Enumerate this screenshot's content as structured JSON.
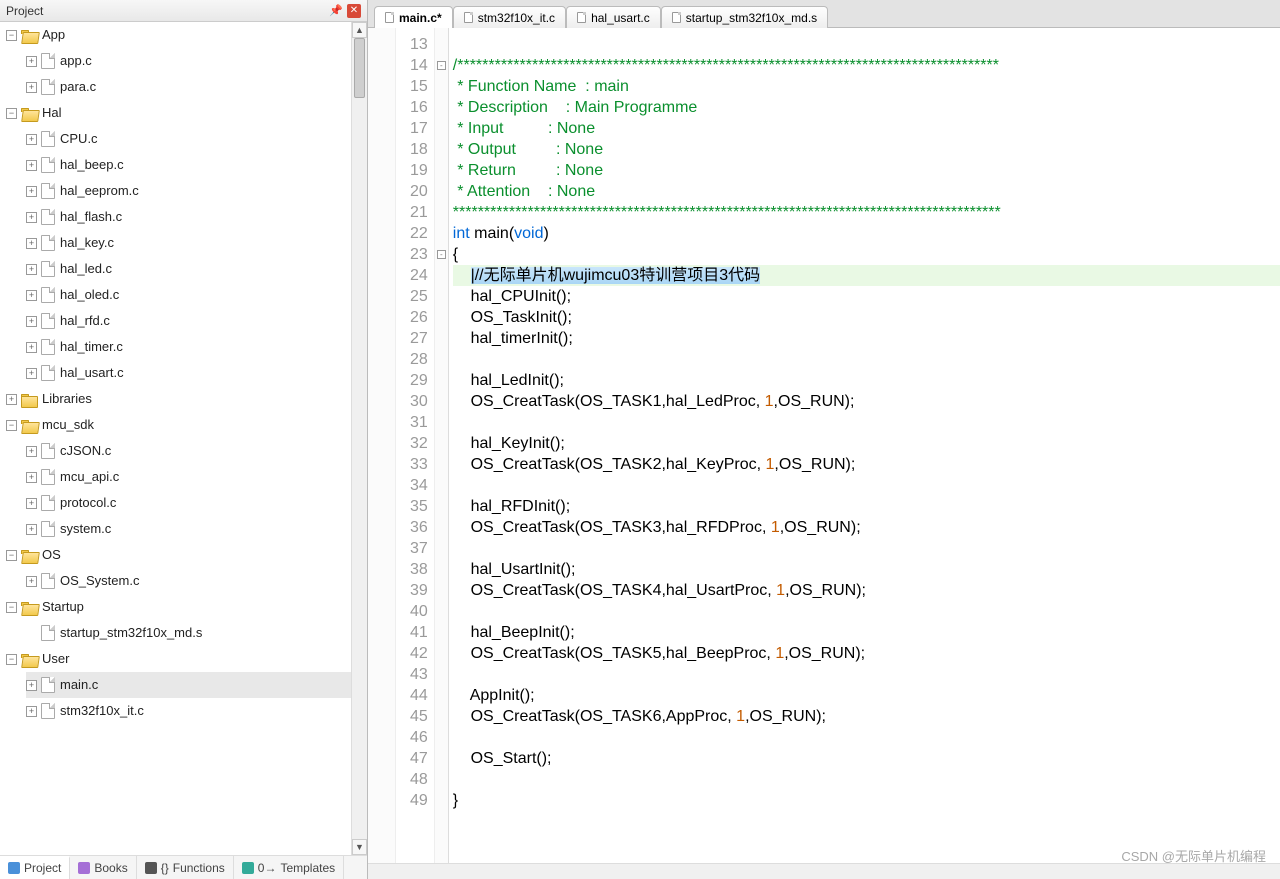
{
  "sidebar": {
    "title": "Project",
    "tabs": [
      {
        "label": "Project",
        "icon": "project-icon"
      },
      {
        "label": "Books",
        "icon": "books-icon"
      },
      {
        "label": "Functions",
        "icon": "functions-icon"
      },
      {
        "label": "Templates",
        "icon": "templates-icon"
      }
    ],
    "tree": [
      {
        "type": "folder",
        "label": "App",
        "expanded": true,
        "level": 1,
        "children": [
          {
            "type": "file",
            "label": "app.c",
            "expandable": true
          },
          {
            "type": "file",
            "label": "para.c",
            "expandable": true
          }
        ]
      },
      {
        "type": "folder",
        "label": "Hal",
        "expanded": true,
        "level": 1,
        "children": [
          {
            "type": "file",
            "label": "CPU.c",
            "expandable": true
          },
          {
            "type": "file",
            "label": "hal_beep.c",
            "expandable": true
          },
          {
            "type": "file",
            "label": "hal_eeprom.c",
            "expandable": true
          },
          {
            "type": "file",
            "label": "hal_flash.c",
            "expandable": true
          },
          {
            "type": "file",
            "label": "hal_key.c",
            "expandable": true
          },
          {
            "type": "file",
            "label": "hal_led.c",
            "expandable": true
          },
          {
            "type": "file",
            "label": "hal_oled.c",
            "expandable": true
          },
          {
            "type": "file",
            "label": "hal_rfd.c",
            "expandable": true
          },
          {
            "type": "file",
            "label": "hal_timer.c",
            "expandable": true
          },
          {
            "type": "file",
            "label": "hal_usart.c",
            "expandable": true
          }
        ]
      },
      {
        "type": "folder",
        "label": "Libraries",
        "expanded": false,
        "level": 1
      },
      {
        "type": "folder",
        "label": "mcu_sdk",
        "expanded": true,
        "level": 1,
        "children": [
          {
            "type": "file",
            "label": "cJSON.c",
            "expandable": true
          },
          {
            "type": "file",
            "label": "mcu_api.c",
            "expandable": true
          },
          {
            "type": "file",
            "label": "protocol.c",
            "expandable": true
          },
          {
            "type": "file",
            "label": "system.c",
            "expandable": true
          }
        ]
      },
      {
        "type": "folder",
        "label": "OS",
        "expanded": true,
        "level": 1,
        "children": [
          {
            "type": "file",
            "label": "OS_System.c",
            "expandable": true
          }
        ]
      },
      {
        "type": "folder",
        "label": "Startup",
        "expanded": true,
        "level": 1,
        "children": [
          {
            "type": "file",
            "label": "startup_stm32f10x_md.s",
            "expandable": false
          }
        ]
      },
      {
        "type": "folder",
        "label": "User",
        "expanded": true,
        "level": 1,
        "children": [
          {
            "type": "file",
            "label": "main.c",
            "expandable": true,
            "selected": true
          },
          {
            "type": "file",
            "label": "stm32f10x_it.c",
            "expandable": true
          }
        ]
      }
    ]
  },
  "editor": {
    "tabs": [
      {
        "label": "main.c*",
        "active": true
      },
      {
        "label": "stm32f10x_it.c",
        "active": false
      },
      {
        "label": "hal_usart.c",
        "active": false
      },
      {
        "label": "startup_stm32f10x_md.s",
        "active": false
      }
    ],
    "first_line": 13,
    "lines": [
      {
        "n": 13,
        "t": ""
      },
      {
        "n": 14,
        "f": "-",
        "t": "/***************************************************************************************",
        "cls": "cm"
      },
      {
        "n": 15,
        "t": " * Function Name  : main",
        "cls": "cm"
      },
      {
        "n": 16,
        "t": " * Description    : Main Programme",
        "cls": "cm"
      },
      {
        "n": 17,
        "t": " * Input          : None",
        "cls": "cm"
      },
      {
        "n": 18,
        "t": " * Output         : None",
        "cls": "cm"
      },
      {
        "n": 19,
        "t": " * Return         : None",
        "cls": "cm"
      },
      {
        "n": 20,
        "t": " * Attention    : None",
        "cls": "cm"
      },
      {
        "n": 21,
        "t": "****************************************************************************************",
        "cls": "cm"
      },
      {
        "n": 22,
        "raw": "<span class=\"c-kw\">int</span> main(<span class=\"c-kw\">void</span>)"
      },
      {
        "n": 23,
        "f": "-",
        "t": "{"
      },
      {
        "n": 24,
        "cur": true,
        "raw": "    <span class=\"hl\">|//无际单片机wujimcu03特训营项目3代码</span>"
      },
      {
        "n": 25,
        "t": "    hal_CPUInit();"
      },
      {
        "n": 26,
        "t": "    OS_TaskInit();"
      },
      {
        "n": 27,
        "t": "    hal_timerInit();"
      },
      {
        "n": 28,
        "t": ""
      },
      {
        "n": 29,
        "t": "    hal_LedInit();"
      },
      {
        "n": 30,
        "raw": "    OS_CreatTask(OS_TASK1,hal_LedProc, <span class=\"c-num\">1</span>,OS_RUN);"
      },
      {
        "n": 31,
        "t": ""
      },
      {
        "n": 32,
        "t": "    hal_KeyInit();"
      },
      {
        "n": 33,
        "raw": "    OS_CreatTask(OS_TASK2,hal_KeyProc, <span class=\"c-num\">1</span>,OS_RUN);"
      },
      {
        "n": 34,
        "t": ""
      },
      {
        "n": 35,
        "t": "    hal_RFDInit();"
      },
      {
        "n": 36,
        "raw": "    OS_CreatTask(OS_TASK3,hal_RFDProc, <span class=\"c-num\">1</span>,OS_RUN);"
      },
      {
        "n": 37,
        "t": ""
      },
      {
        "n": 38,
        "t": "    hal_UsartInit();"
      },
      {
        "n": 39,
        "raw": "    OS_CreatTask(OS_TASK4,hal_UsartProc, <span class=\"c-num\">1</span>,OS_RUN);"
      },
      {
        "n": 40,
        "t": ""
      },
      {
        "n": 41,
        "t": "    hal_BeepInit();"
      },
      {
        "n": 42,
        "raw": "    OS_CreatTask(OS_TASK5,hal_BeepProc, <span class=\"c-num\">1</span>,OS_RUN);"
      },
      {
        "n": 43,
        "t": ""
      },
      {
        "n": 44,
        "t": "    AppInit();"
      },
      {
        "n": 45,
        "raw": "    OS_CreatTask(OS_TASK6,AppProc, <span class=\"c-num\">1</span>,OS_RUN);"
      },
      {
        "n": 46,
        "t": ""
      },
      {
        "n": 47,
        "t": "    OS_Start();"
      },
      {
        "n": 48,
        "t": ""
      },
      {
        "n": 49,
        "t": "}"
      }
    ]
  },
  "watermark": "CSDN @无际单片机编程"
}
